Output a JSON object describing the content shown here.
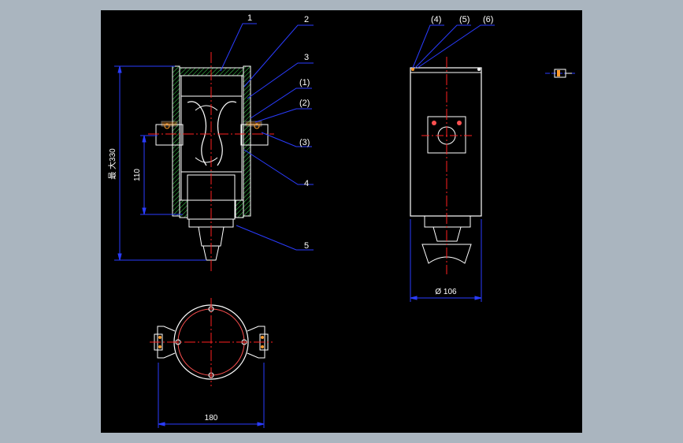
{
  "colors": {
    "background": "#aab5bf",
    "drawing_area": "#000000",
    "outline": "#ffffff",
    "centerline": "#ff2020",
    "leader_dimension": "#2a3cff",
    "hatch": "#39c24a",
    "bolt": "#ff9a2a",
    "ring": "#ff5050"
  },
  "labels": {
    "p1": "1",
    "p2": "2",
    "p3": "3",
    "p_1": "(1)",
    "p_2": "(2)",
    "p_3": "(3)",
    "p4": "4",
    "p5": "5",
    "p_4": "(4)",
    "p_5": "(5)",
    "p_6": "(6)"
  },
  "dimensions": {
    "total_height": "最 大330",
    "height_110": "110",
    "diameter": "Ø 106",
    "width_180": "180"
  }
}
